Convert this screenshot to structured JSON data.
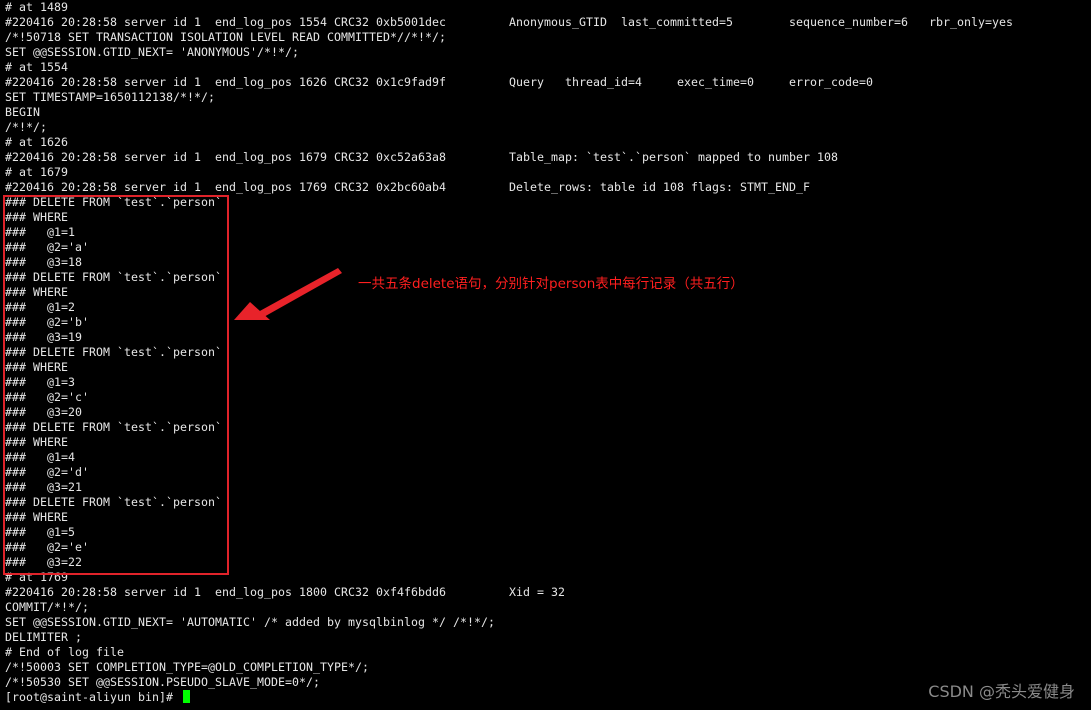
{
  "terminal": {
    "lines": [
      {
        "a": "# at 1489"
      },
      {
        "a": "#220416 20:28:58 server id 1  end_log_pos 1554 CRC32 0xb5001dec",
        "b": "Anonymous_GTID  last_committed=5",
        "d": "sequence_number=6",
        "e": "rbr_only=yes"
      },
      {
        "a": "/*!50718 SET TRANSACTION ISOLATION LEVEL READ COMMITTED*//*!*/;"
      },
      {
        "a": "SET @@SESSION.GTID_NEXT= 'ANONYMOUS'/*!*/;"
      },
      {
        "a": "# at 1554"
      },
      {
        "a": "#220416 20:28:58 server id 1  end_log_pos 1626 CRC32 0x1c9fad9f",
        "qb": "Query",
        "qc": "thread_id=4",
        "qd": "exec_time=0",
        "qe": "error_code=0"
      },
      {
        "a": "SET TIMESTAMP=1650112138/*!*/;"
      },
      {
        "a": "BEGIN"
      },
      {
        "a": "/*!*/;"
      },
      {
        "a": "# at 1626"
      },
      {
        "a": "#220416 20:28:58 server id 1  end_log_pos 1679 CRC32 0xc52a63a8",
        "b": "Table_map: `test`.`person` mapped to number 108"
      },
      {
        "a": "# at 1679"
      },
      {
        "a": "#220416 20:28:58 server id 1  end_log_pos 1769 CRC32 0x2bc60ab4",
        "b": "Delete_rows: table id 108 flags: STMT_END_F"
      },
      {
        "a": "### DELETE FROM `test`.`person`"
      },
      {
        "a": "### WHERE"
      },
      {
        "a": "###   @1=1"
      },
      {
        "a": "###   @2='a'"
      },
      {
        "a": "###   @3=18"
      },
      {
        "a": "### DELETE FROM `test`.`person`"
      },
      {
        "a": "### WHERE"
      },
      {
        "a": "###   @1=2"
      },
      {
        "a": "###   @2='b'"
      },
      {
        "a": "###   @3=19"
      },
      {
        "a": "### DELETE FROM `test`.`person`"
      },
      {
        "a": "### WHERE"
      },
      {
        "a": "###   @1=3"
      },
      {
        "a": "###   @2='c'"
      },
      {
        "a": "###   @3=20"
      },
      {
        "a": "### DELETE FROM `test`.`person`"
      },
      {
        "a": "### WHERE"
      },
      {
        "a": "###   @1=4"
      },
      {
        "a": "###   @2='d'"
      },
      {
        "a": "###   @3=21"
      },
      {
        "a": "### DELETE FROM `test`.`person`"
      },
      {
        "a": "### WHERE"
      },
      {
        "a": "###   @1=5"
      },
      {
        "a": "###   @2='e'"
      },
      {
        "a": "###   @3=22"
      },
      {
        "a": "# at 1769"
      },
      {
        "a": "#220416 20:28:58 server id 1  end_log_pos 1800 CRC32 0xf4f6bdd6",
        "b": "Xid = 32"
      },
      {
        "a": "COMMIT/*!*/;"
      },
      {
        "a": "SET @@SESSION.GTID_NEXT= 'AUTOMATIC' /* added by mysqlbinlog */ /*!*/;"
      },
      {
        "a": "DELIMITER ;"
      },
      {
        "a": "# End of log file"
      },
      {
        "a": "/*!50003 SET COMPLETION_TYPE=@OLD_COMPLETION_TYPE*/;"
      },
      {
        "a": "/*!50530 SET @@SESSION.PSEUDO_SLAVE_MODE=0*/;"
      }
    ],
    "prompt": "[root@saint-aliyun bin]# ",
    "cursor_color": "#00ff00",
    "text_color": "#e6e6e6",
    "background": "#000000"
  },
  "annotation": {
    "text": "一共五条delete语句，分别针对person表中每行记录（共五行）",
    "color": "#ff1f1f",
    "box_color": "#e0232a"
  },
  "watermark": {
    "text": "CSDN @秃头爱健身"
  }
}
